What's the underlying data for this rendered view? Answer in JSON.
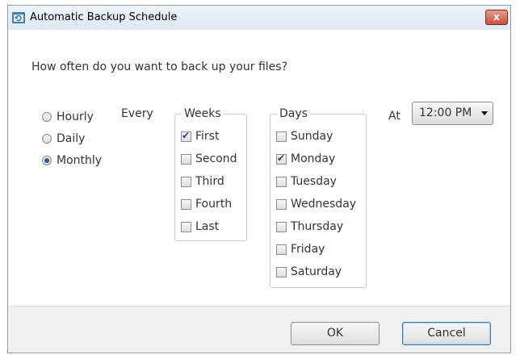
{
  "window": {
    "title": "Automatic Backup Schedule",
    "close_label": "x",
    "accent_color": "#c7503a"
  },
  "question": "How often do you want to back up your files?",
  "frequency": {
    "options": [
      "Hourly",
      "Daily",
      "Monthly"
    ],
    "selected": "Monthly"
  },
  "every_label": "Every",
  "weeks": {
    "title": "Weeks",
    "items": [
      {
        "label": "First",
        "checked": true
      },
      {
        "label": "Second",
        "checked": false
      },
      {
        "label": "Third",
        "checked": false
      },
      {
        "label": "Fourth",
        "checked": false
      },
      {
        "label": "Last",
        "checked": false
      }
    ]
  },
  "days": {
    "title": "Days",
    "items": [
      {
        "label": "Sunday",
        "checked": false
      },
      {
        "label": "Monday",
        "checked": true
      },
      {
        "label": "Tuesday",
        "checked": false
      },
      {
        "label": "Wednesday",
        "checked": false
      },
      {
        "label": "Thursday",
        "checked": false
      },
      {
        "label": "Friday",
        "checked": false
      },
      {
        "label": "Saturday",
        "checked": false
      }
    ]
  },
  "time": {
    "label": "At",
    "value": "12:00 PM"
  },
  "buttons": {
    "ok": "OK",
    "cancel": "Cancel"
  }
}
